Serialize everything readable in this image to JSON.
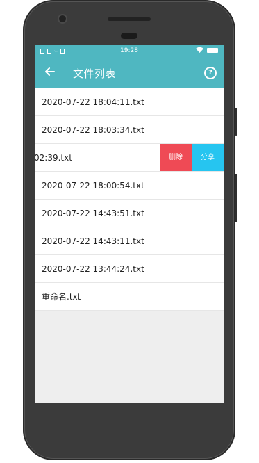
{
  "statusbar": {
    "time": "19:28"
  },
  "appbar": {
    "title": "文件列表",
    "back_icon": "arrow-left-icon",
    "help_icon": "help-circle-icon",
    "help_glyph": "?"
  },
  "files": [
    {
      "name": "2020-07-22 18:04:11.txt"
    },
    {
      "name": "2020-07-22 18:03:34.txt"
    },
    {
      "name": "02:39.txt"
    },
    {
      "name": "2020-07-22 18:00:54.txt"
    },
    {
      "name": "2020-07-22 14:43:51.txt"
    },
    {
      "name": "2020-07-22 14:43:11.txt"
    },
    {
      "name": "2020-07-22 13:44:24.txt"
    },
    {
      "name": "重命名.txt"
    }
  ],
  "actions": {
    "delete_label": "删除",
    "share_label": "分享"
  },
  "colors": {
    "accent": "#4fb7c1",
    "delete": "#ef4a55",
    "share": "#26c5f0"
  }
}
